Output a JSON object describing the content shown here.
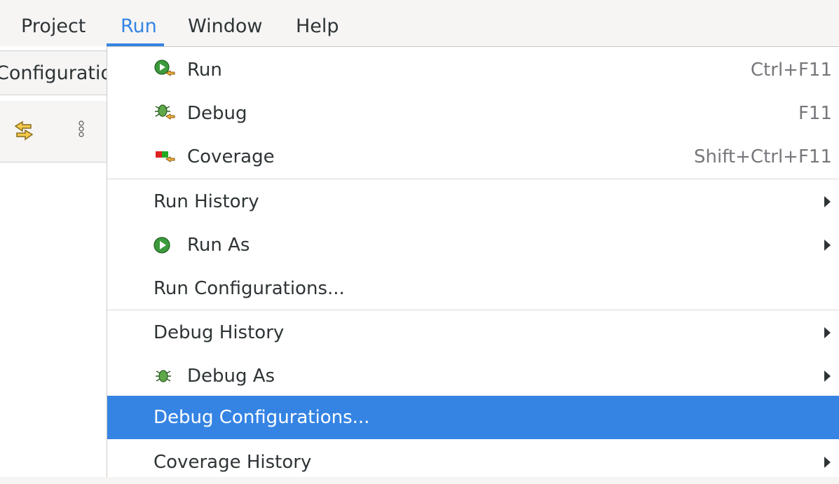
{
  "menubar": {
    "items": [
      {
        "label": "Project"
      },
      {
        "label": "Run"
      },
      {
        "label": "Window"
      },
      {
        "label": "Help"
      }
    ],
    "active": "Run"
  },
  "background": {
    "title_fragment": "Configuratio"
  },
  "run_menu": {
    "items": [
      {
        "label": "Run",
        "accel": "Ctrl+F11",
        "icon": "run-icon"
      },
      {
        "label": "Debug",
        "accel": "F11",
        "icon": "debug-icon"
      },
      {
        "label": "Coverage",
        "accel": "Shift+Ctrl+F11",
        "icon": "coverage-icon"
      },
      {
        "label": "Run History",
        "submenu": true
      },
      {
        "label": "Run As",
        "submenu": true,
        "icon": "run-as-icon"
      },
      {
        "label": "Run Configurations..."
      },
      {
        "label": "Debug History",
        "submenu": true
      },
      {
        "label": "Debug As",
        "submenu": true,
        "icon": "debug-as-icon"
      },
      {
        "label": "Debug Configurations...",
        "highlighted": true
      },
      {
        "label": "Coverage History",
        "submenu": true
      }
    ]
  },
  "colors": {
    "accent": "#3584e4",
    "menu_bg": "#ffffff",
    "window_bg": "#f6f5f4",
    "text": "#2e3436",
    "accel_text": "#77767b"
  }
}
